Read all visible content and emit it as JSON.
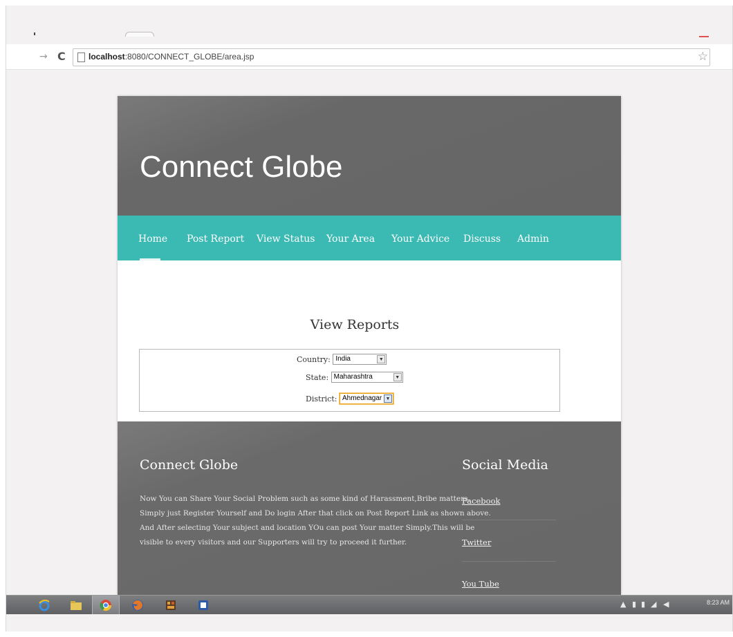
{
  "browser": {
    "url_host": "localhost",
    "url_path": ":8080/CONNECT_GLOBE/area.jsp",
    "forward_glyph": "→",
    "reload_glyph": "C",
    "star_glyph": "☆"
  },
  "site": {
    "title": "Connect Globe",
    "menu": [
      "Home",
      "Post Report",
      "View Status",
      "Your Area",
      "Your Advice",
      "Discuss",
      "Admin"
    ],
    "content": {
      "title": "View Reports",
      "country_label": "Country:",
      "country_value": "India",
      "state_label": "State:",
      "state_value": "Maharashtra",
      "district_label": "District:",
      "district_value": "Ahmednagar",
      "dropdown_glyph": "▼"
    },
    "footer": {
      "title": "Connect Globe",
      "text_lines": [
        "Now You can Share Your Social Problem such as some kind of Harassment,Bribe matters.",
        "Simply just Register Yourself and Do login After that click on Post Report Link as shown above.",
        "And After selecting Your subject and location YOu can post Your matter Simply.This will be",
        "visible to every visitors and our Supporters will try to proceed it further."
      ],
      "social_title": "Social Media",
      "social_links": [
        "Facebook",
        "Twitter",
        "You Tube"
      ]
    }
  },
  "taskbar": {
    "clock": "8:23 AM"
  },
  "colors": {
    "header_bg": "#686868",
    "menu_bg": "#3bb9b3",
    "footer_bg": "#686868"
  }
}
